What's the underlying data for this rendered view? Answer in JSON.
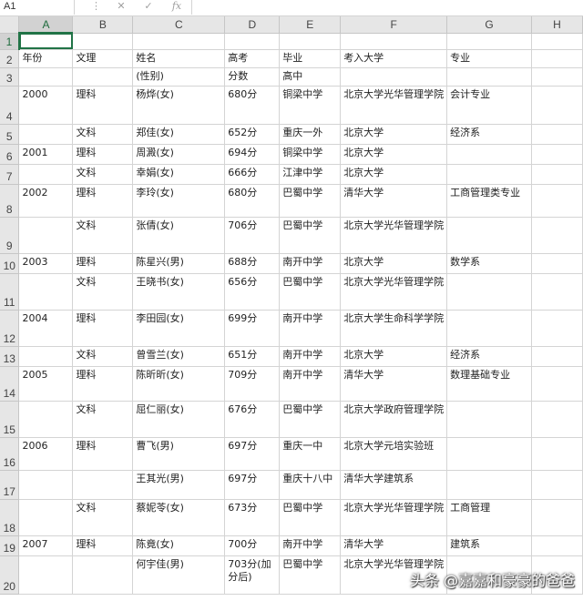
{
  "formula_bar": {
    "name_box": "A1",
    "menu_glyph": "⋮",
    "cancel_glyph": "✕",
    "enter_glyph": "✓",
    "fx_glyph": "fx"
  },
  "columns": [
    "A",
    "B",
    "C",
    "D",
    "E",
    "F",
    "G",
    "H"
  ],
  "rows": [
    {
      "n": "1",
      "cells": [
        "",
        "",
        "",
        "",
        "",
        "",
        "",
        ""
      ]
    },
    {
      "n": "2",
      "cells": [
        "年份",
        "文理",
        "姓名",
        "高考",
        "毕业",
        "考入大学",
        "专业",
        ""
      ]
    },
    {
      "n": "3",
      "cells": [
        "",
        "",
        "(性别)",
        "分数",
        "高中",
        "",
        "",
        ""
      ]
    },
    {
      "n": "4",
      "cells": [
        "2000",
        "理科",
        "杨烨(女)",
        "680分",
        "铜梁中学",
        "北京大学光华管理学院",
        "会计专业",
        ""
      ]
    },
    {
      "n": "5",
      "cells": [
        "",
        "文科",
        "郑佳(女)",
        "652分",
        "重庆一外",
        "北京大学",
        "经济系",
        ""
      ]
    },
    {
      "n": "6",
      "cells": [
        "2001",
        "理科",
        "周澱(女)",
        "694分",
        "铜梁中学",
        "北京大学",
        "",
        ""
      ]
    },
    {
      "n": "7",
      "cells": [
        "",
        "文科",
        "幸娟(女)",
        "666分",
        "江津中学",
        "北京大学",
        "",
        ""
      ]
    },
    {
      "n": "8",
      "cells": [
        "2002",
        "理科",
        "李玲(女)",
        "680分",
        "巴蜀中学",
        "清华大学",
        "工商管理类专业",
        ""
      ]
    },
    {
      "n": "9",
      "cells": [
        "",
        "文科",
        "张倩(女)",
        "706分",
        "巴蜀中学",
        "北京大学光华管理学院",
        "",
        ""
      ]
    },
    {
      "n": "10",
      "cells": [
        "2003",
        "理科",
        "陈星兴(男)",
        "688分",
        "南开中学",
        "北京大学",
        "数学系",
        ""
      ]
    },
    {
      "n": "11",
      "cells": [
        "",
        "文科",
        "王晓书(女)",
        "656分",
        "巴蜀中学",
        "北京大学光华管理学院",
        "",
        ""
      ]
    },
    {
      "n": "12",
      "cells": [
        "2004",
        "理科",
        "李田园(女)",
        "699分",
        "南开中学",
        "北京大学生命科学学院",
        "",
        ""
      ]
    },
    {
      "n": "13",
      "cells": [
        "",
        "文科",
        "曾雪兰(女)",
        "651分",
        "南开中学",
        "北京大学",
        "经济系",
        ""
      ]
    },
    {
      "n": "14",
      "cells": [
        "2005",
        "理科",
        "陈昕昕(女)",
        "709分",
        "南开中学",
        "清华大学",
        "数理基础专业",
        ""
      ]
    },
    {
      "n": "15",
      "cells": [
        "",
        "文科",
        "屈仁丽(女)",
        "676分",
        "巴蜀中学",
        "北京大学政府管理学院",
        "",
        ""
      ]
    },
    {
      "n": "16",
      "cells": [
        "2006",
        "理科",
        "曹飞(男)",
        "697分",
        "重庆一中",
        "北京大学元培实验班",
        "",
        ""
      ]
    },
    {
      "n": "17",
      "cells": [
        "",
        "",
        "王其光(男)",
        "697分",
        "重庆十八中",
        "清华大学建筑系",
        "",
        ""
      ]
    },
    {
      "n": "18",
      "cells": [
        "",
        "文科",
        "蔡妮苓(女)",
        "673分",
        "巴蜀中学",
        "北京大学光华管理学院",
        "工商管理",
        ""
      ]
    },
    {
      "n": "19",
      "cells": [
        "2007",
        "理科",
        "陈竟(女)",
        "700分",
        "南开中学",
        "清华大学",
        "建筑系",
        ""
      ]
    },
    {
      "n": "20",
      "cells": [
        "",
        "",
        "何宇佳(男)",
        "703分(加分后)",
        "巴蜀中学",
        "北京大学光华管理学院",
        "",
        ""
      ]
    }
  ],
  "watermark": "头条 @嘉嘉和豪豪的爸爸"
}
